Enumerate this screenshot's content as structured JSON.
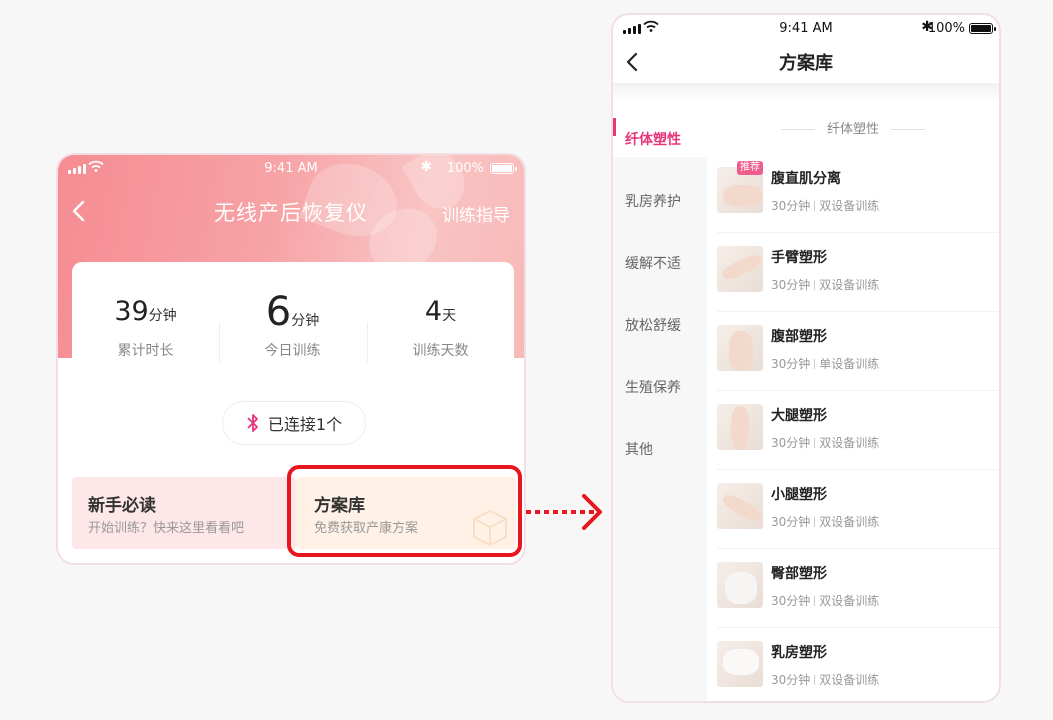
{
  "status": {
    "time": "9:41 AM",
    "battery": "100%"
  },
  "left": {
    "title": "无线产后恢复仪",
    "guide": "训练指导",
    "stats": [
      {
        "value": "39",
        "unit": "分钟",
        "label": "累计时长"
      },
      {
        "value": "6",
        "unit": "分钟",
        "label": "今日训练"
      },
      {
        "value": "4",
        "unit": "天",
        "label": "训练天数"
      }
    ],
    "connection": "已连接1个",
    "card_read": {
      "title": "新手必读",
      "sub": "开始训练？快来这里看看吧"
    },
    "card_plan": {
      "title": "方案库",
      "sub": "免费获取产康方案"
    }
  },
  "right": {
    "title": "方案库",
    "categories": [
      "纤体塑性",
      "乳房养护",
      "缓解不适",
      "放松舒缓",
      "生殖保养",
      "其他"
    ],
    "section_title": "纤体塑性",
    "plans": [
      {
        "name": "腹直肌分离",
        "duration": "30分钟",
        "device": "双设备训练",
        "tag": "推荐"
      },
      {
        "name": "手臂塑形",
        "duration": "30分钟",
        "device": "双设备训练"
      },
      {
        "name": "腹部塑形",
        "duration": "30分钟",
        "device": "单设备训练"
      },
      {
        "name": "大腿塑形",
        "duration": "30分钟",
        "device": "双设备训练"
      },
      {
        "name": "小腿塑形",
        "duration": "30分钟",
        "device": "双设备训练"
      },
      {
        "name": "臀部塑形",
        "duration": "30分钟",
        "device": "双设备训练"
      },
      {
        "name": "乳房塑形",
        "duration": "30分钟",
        "device": "双设备训练"
      }
    ]
  },
  "colors": {
    "accent": "#e8367a",
    "header": "#f58c92",
    "highlight": "#e8161f"
  }
}
